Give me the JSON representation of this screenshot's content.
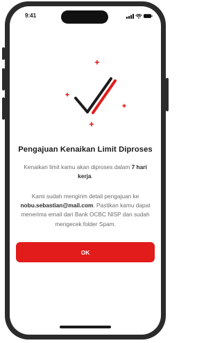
{
  "status_bar": {
    "time": "9:41",
    "icons": [
      "signal-icon",
      "wifi-icon",
      "battery-icon"
    ]
  },
  "illustration": {
    "icon": "checkmark-success-icon",
    "colors": {
      "check": "#1b1b1b",
      "accent": "#e21b1b"
    }
  },
  "content": {
    "title": "Pengajuan Kenaikan Limit Diproses",
    "p1_prefix": "Kenaikan limit kamu akan diproses dalam ",
    "p1_bold": "7 hari kerja",
    "p1_suffix": ".",
    "p2_prefix": "Kami sudah mengirim detail pengajuan ke ",
    "p2_email": "nobu.sebastian@mail.com",
    "p2_suffix": ". Pastikan kamu dapat menerima email dari Bank OCBC NISP dan sudah mengecek folder Spam."
  },
  "actions": {
    "ok_label": "OK",
    "button_color": "#e21b1b"
  }
}
